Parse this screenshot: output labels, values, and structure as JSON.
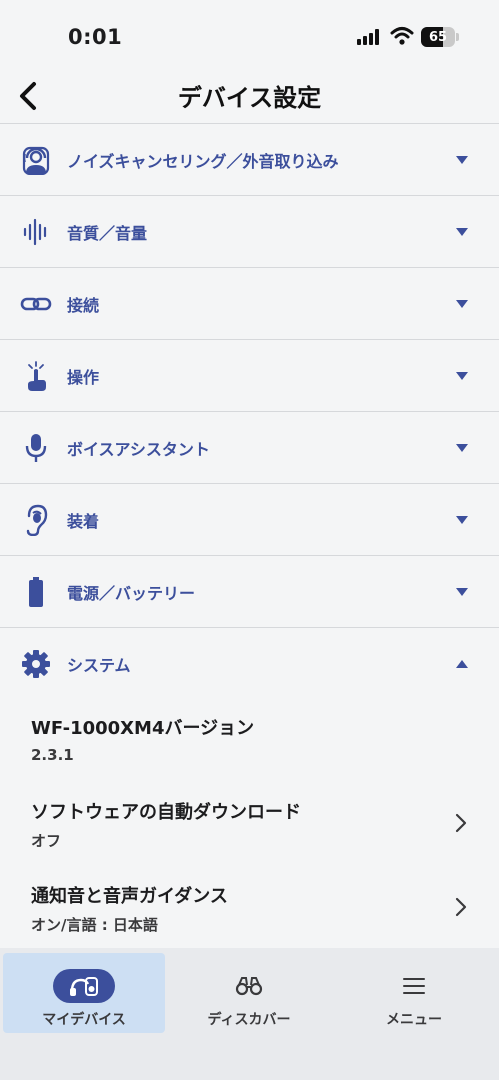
{
  "status_bar": {
    "time": "0:01",
    "battery_percent": "65",
    "battery_level": 0.65
  },
  "header": {
    "title": "デバイス設定"
  },
  "sections": [
    {
      "label": "ノイズキャンセリング／外音取り込み",
      "icon": "person-sound-icon",
      "expanded": false
    },
    {
      "label": "音質／音量",
      "icon": "sound-wave-icon",
      "expanded": false
    },
    {
      "label": "接続",
      "icon": "link-icon",
      "expanded": false
    },
    {
      "label": "操作",
      "icon": "tap-hand-icon",
      "expanded": false
    },
    {
      "label": "ボイスアシスタント",
      "icon": "microphone-icon",
      "expanded": false
    },
    {
      "label": "装着",
      "icon": "ear-icon",
      "expanded": false
    },
    {
      "label": "電源／バッテリー",
      "icon": "battery-icon",
      "expanded": false
    },
    {
      "label": "システム",
      "icon": "gear-icon",
      "expanded": true
    }
  ],
  "system_items": [
    {
      "title": "WF-1000XM4バージョン",
      "value": "2.3.1",
      "navigable": false
    },
    {
      "title": "ソフトウェアの自動ダウンロード",
      "value": "オフ",
      "navigable": true
    },
    {
      "title": "通知音と音声ガイダンス",
      "value": "オン/言語 : 日本語",
      "navigable": true
    }
  ],
  "tabs": [
    {
      "label": "マイデバイス",
      "icon": "headphones-device-icon",
      "active": true
    },
    {
      "label": "ディスカバー",
      "icon": "binoculars-icon",
      "active": false
    },
    {
      "label": "メニュー",
      "icon": "menu-icon",
      "active": false
    }
  ],
  "colors": {
    "accent": "#3c4f9c",
    "active_tab_bg": "#cddff3",
    "tab_bar_bg": "#e8eaed",
    "background": "#f4f5f6"
  }
}
